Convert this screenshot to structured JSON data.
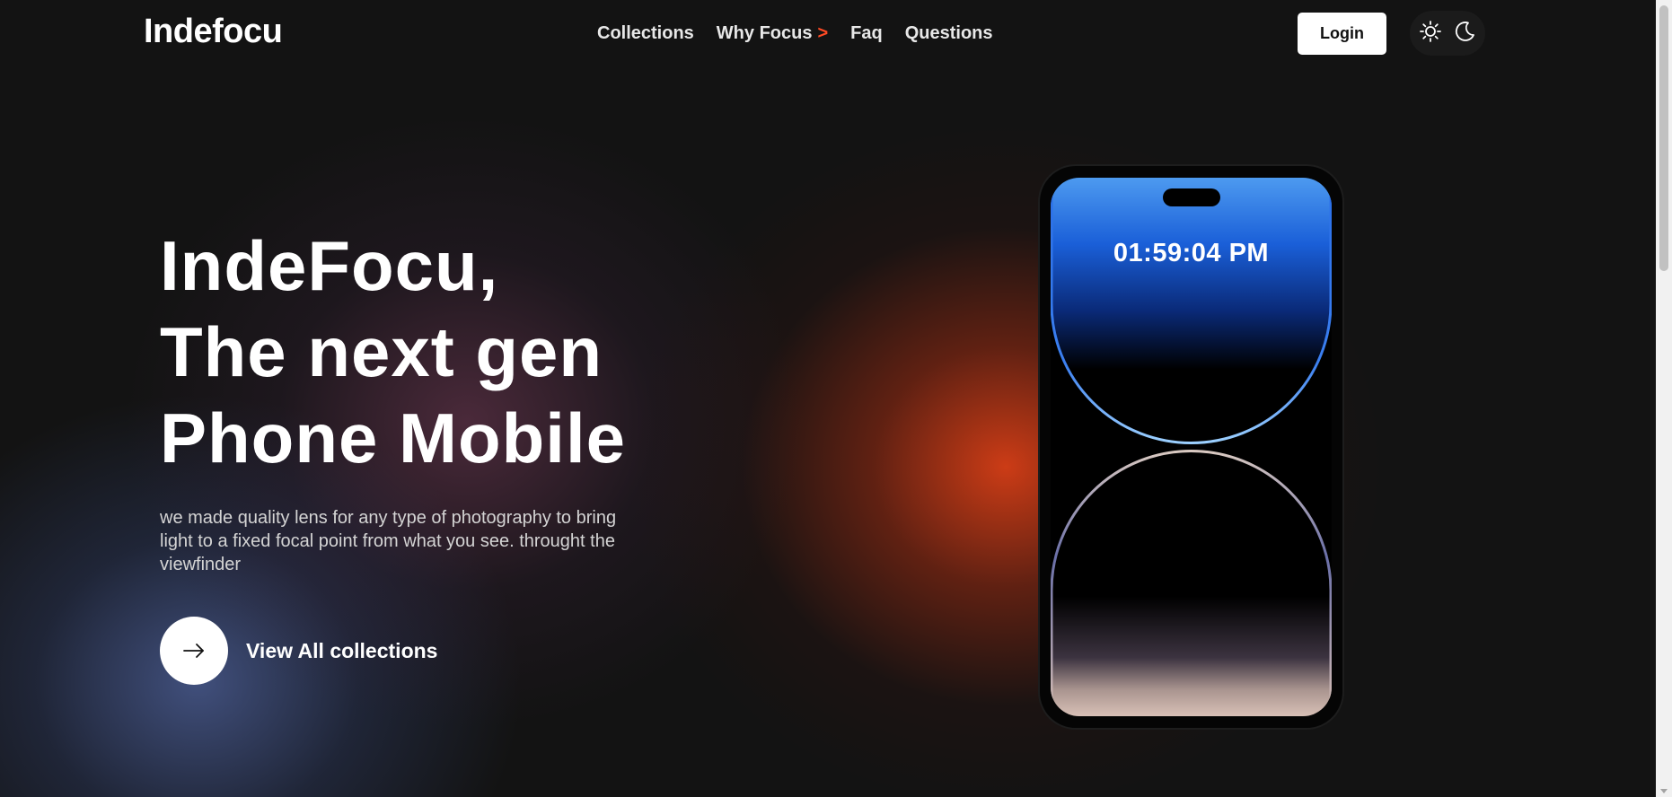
{
  "header": {
    "logo": "Indefocu",
    "nav": [
      {
        "label": "Collections"
      },
      {
        "label": "Why Focus",
        "suffix": ">"
      },
      {
        "label": "Faq"
      },
      {
        "label": "Questions"
      }
    ],
    "login_label": "Login",
    "theme_icons": [
      "sun-icon",
      "moon-icon"
    ]
  },
  "hero": {
    "title_lines": [
      "IndeFocu,",
      "The next gen",
      "Phone Mobile"
    ],
    "description": "we made quality lens for any type of photography to bring light to a fixed focal point from what you see. throught the viewfinder",
    "cta_label": "View All collections",
    "cta_icon": "arrow-right-icon"
  },
  "phone": {
    "time": "01:59:04 PM"
  },
  "colors": {
    "background": "#131313",
    "accent": "#ff4a24",
    "button_bg": "#ffffff"
  }
}
